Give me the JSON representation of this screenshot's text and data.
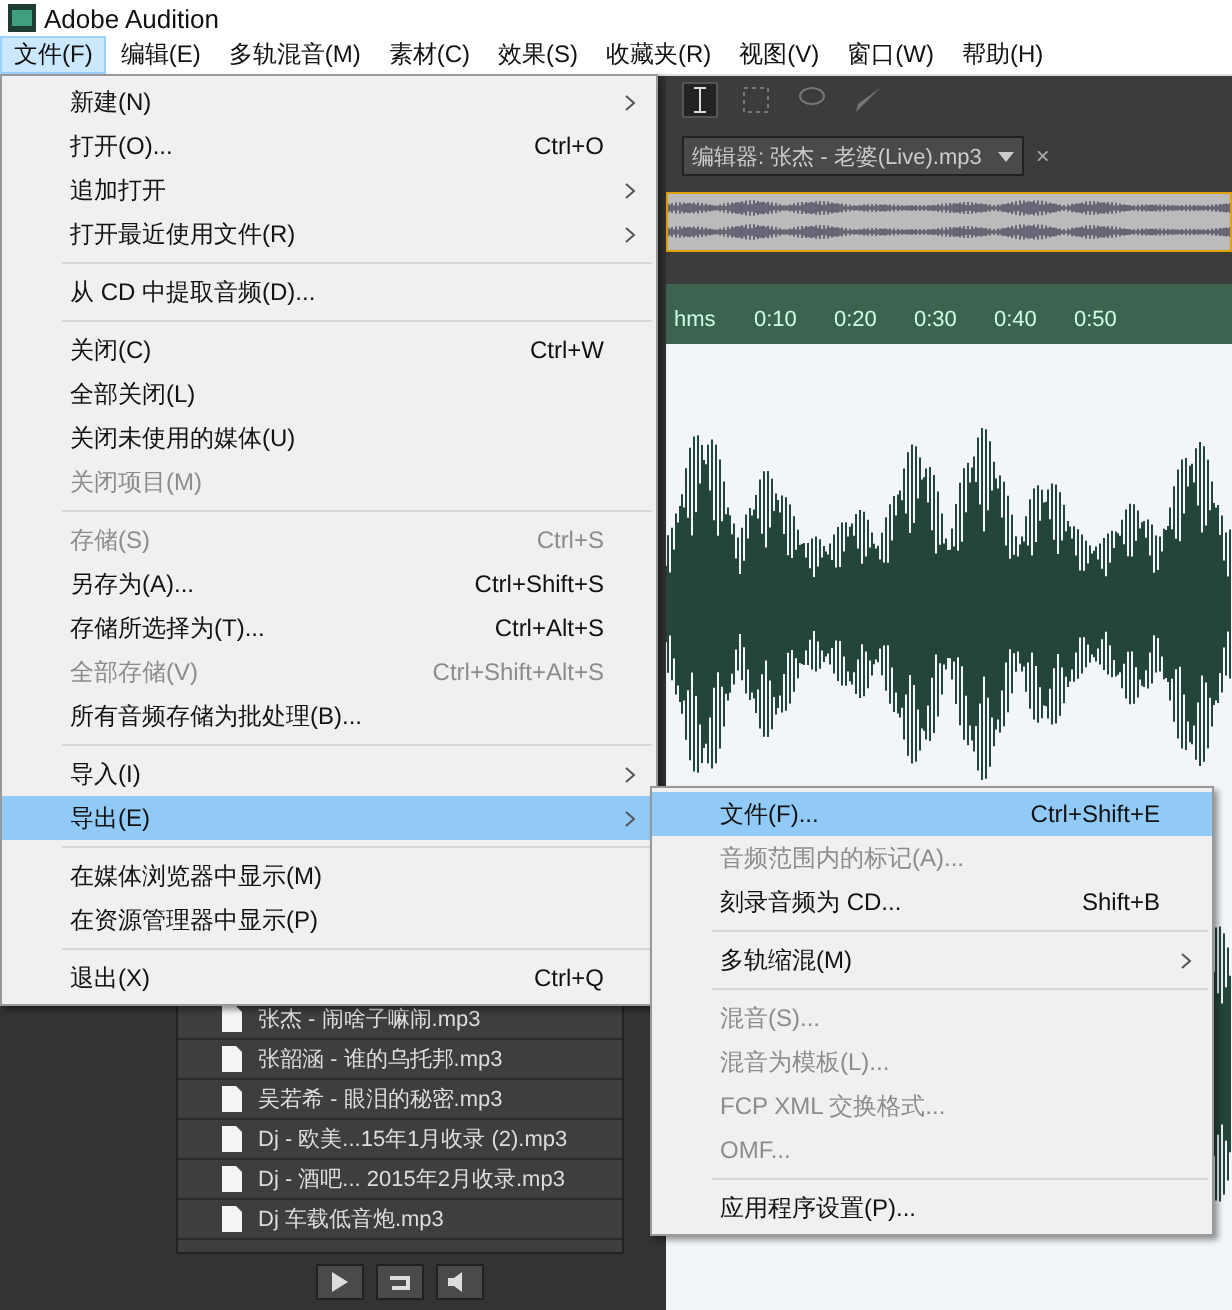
{
  "app": {
    "title": "Adobe Audition"
  },
  "menubar": [
    {
      "label": "文件(F)",
      "selected": true
    },
    {
      "label": "编辑(E)",
      "selected": false
    },
    {
      "label": "多轨混音(M)",
      "selected": false
    },
    {
      "label": "素材(C)",
      "selected": false
    },
    {
      "label": "效果(S)",
      "selected": false
    },
    {
      "label": "收藏夹(R)",
      "selected": false
    },
    {
      "label": "视图(V)",
      "selected": false
    },
    {
      "label": "窗口(W)",
      "selected": false
    },
    {
      "label": "帮助(H)",
      "selected": false
    }
  ],
  "editor": {
    "tab": "编辑器: 张杰 - 老婆(Live).mp3",
    "close": "×",
    "ruler": [
      "hms",
      "0:10",
      "0:20",
      "0:30",
      "0:40",
      "0:50"
    ]
  },
  "files": [
    "张杰 - 闹啥子嘛闹.mp3",
    "张韶涵 - 谁的乌托邦.mp3",
    "吴若希 - 眼泪的秘密.mp3",
    "Dj - 欧美...15年1月收录 (2).mp3",
    "Dj - 酒吧... 2015年2月收录.mp3",
    "Dj 车载低音炮.mp3"
  ],
  "file_menu": [
    {
      "kind": "item",
      "label": "新建(N)",
      "submenu": true,
      "disabled": false,
      "selected": false
    },
    {
      "kind": "item",
      "label": "打开(O)...",
      "shortcut": "Ctrl+O",
      "submenu": false,
      "disabled": false,
      "selected": false
    },
    {
      "kind": "item",
      "label": "追加打开",
      "submenu": true,
      "disabled": false,
      "selected": false
    },
    {
      "kind": "item",
      "label": "打开最近使用文件(R)",
      "submenu": true,
      "disabled": false,
      "selected": false
    },
    {
      "kind": "separator"
    },
    {
      "kind": "item",
      "label": "从 CD 中提取音频(D)...",
      "submenu": false,
      "disabled": false,
      "selected": false
    },
    {
      "kind": "separator"
    },
    {
      "kind": "item",
      "label": "关闭(C)",
      "shortcut": "Ctrl+W",
      "submenu": false,
      "disabled": false,
      "selected": false
    },
    {
      "kind": "item",
      "label": "全部关闭(L)",
      "submenu": false,
      "disabled": false,
      "selected": false
    },
    {
      "kind": "item",
      "label": "关闭未使用的媒体(U)",
      "submenu": false,
      "disabled": false,
      "selected": false
    },
    {
      "kind": "item",
      "label": "关闭项目(M)",
      "submenu": false,
      "disabled": true,
      "selected": false
    },
    {
      "kind": "separator"
    },
    {
      "kind": "item",
      "label": "存储(S)",
      "shortcut": "Ctrl+S",
      "submenu": false,
      "disabled": true,
      "selected": false
    },
    {
      "kind": "item",
      "label": "另存为(A)...",
      "shortcut": "Ctrl+Shift+S",
      "submenu": false,
      "disabled": false,
      "selected": false
    },
    {
      "kind": "item",
      "label": "存储所选择为(T)...",
      "shortcut": "Ctrl+Alt+S",
      "submenu": false,
      "disabled": false,
      "selected": false
    },
    {
      "kind": "item",
      "label": "全部存储(V)",
      "shortcut": "Ctrl+Shift+Alt+S",
      "submenu": false,
      "disabled": true,
      "selected": false
    },
    {
      "kind": "item",
      "label": "所有音频存储为批处理(B)...",
      "submenu": false,
      "disabled": false,
      "selected": false
    },
    {
      "kind": "separator"
    },
    {
      "kind": "item",
      "label": "导入(I)",
      "submenu": true,
      "disabled": false,
      "selected": false
    },
    {
      "kind": "item",
      "label": "导出(E)",
      "submenu": true,
      "disabled": false,
      "selected": true
    },
    {
      "kind": "separator"
    },
    {
      "kind": "item",
      "label": "在媒体浏览器中显示(M)",
      "submenu": false,
      "disabled": false,
      "selected": false
    },
    {
      "kind": "item",
      "label": "在资源管理器中显示(P)",
      "submenu": false,
      "disabled": false,
      "selected": false
    },
    {
      "kind": "separator"
    },
    {
      "kind": "item",
      "label": "退出(X)",
      "shortcut": "Ctrl+Q",
      "submenu": false,
      "disabled": false,
      "selected": false
    }
  ],
  "export_menu": [
    {
      "kind": "item",
      "label": "文件(F)...",
      "shortcut": "Ctrl+Shift+E",
      "submenu": false,
      "disabled": false,
      "selected": true
    },
    {
      "kind": "item",
      "label": "音频范围内的标记(A)...",
      "submenu": false,
      "disabled": true,
      "selected": false
    },
    {
      "kind": "item",
      "label": "刻录音频为 CD...",
      "shortcut": "Shift+B",
      "submenu": false,
      "disabled": false,
      "selected": false
    },
    {
      "kind": "separator"
    },
    {
      "kind": "item",
      "label": "多轨缩混(M)",
      "submenu": true,
      "disabled": false,
      "selected": false
    },
    {
      "kind": "separator"
    },
    {
      "kind": "item",
      "label": "混音(S)...",
      "submenu": false,
      "disabled": true,
      "selected": false
    },
    {
      "kind": "item",
      "label": "混音为模板(L)...",
      "submenu": false,
      "disabled": true,
      "selected": false
    },
    {
      "kind": "item",
      "label": "FCP XML 交换格式...",
      "submenu": false,
      "disabled": true,
      "selected": false
    },
    {
      "kind": "item",
      "label": "OMF...",
      "submenu": false,
      "disabled": true,
      "selected": false
    },
    {
      "kind": "separator"
    },
    {
      "kind": "item",
      "label": "应用程序设置(P)...",
      "submenu": false,
      "disabled": false,
      "selected": false
    }
  ]
}
